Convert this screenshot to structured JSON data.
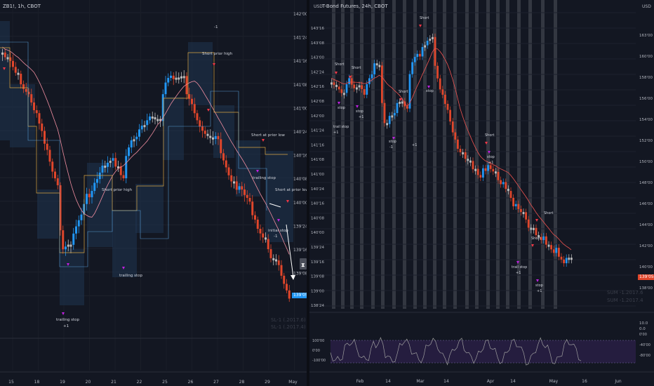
{
  "left": {
    "title": "ZB1!, 1h, CBOT",
    "price_labels": [
      "142'00",
      "141'24",
      "141'16",
      "141'08",
      "141'00",
      "140'24",
      "140'16",
      "140'08",
      "140'00",
      "139'24",
      "139'16",
      "139'08",
      "139'00"
    ],
    "current_price": "139'05",
    "date_labels": [
      "15",
      "18",
      "19",
      "20",
      "21",
      "22",
      "25",
      "26",
      "27",
      "28",
      "29",
      "May"
    ],
    "annotations": {
      "short_top": "-1",
      "short_prior_high_1": "Short prior high",
      "short_prior_high_2": "Short prior high",
      "short_at_prior_low_1": "Short at prior low",
      "short_at_prior_low_2": "Short at prior low",
      "trailing_stop_1": "trailing stop",
      "trailing_stop_1_val": "+1",
      "trailing_stop_2": "trailing stop",
      "trailing_stop_3": "trailing stop",
      "initial_stop": "initial stop",
      "initial_stop_val": "-1"
    },
    "watermark": [
      "SL-1 (.2017.6)",
      "SL-1 (.2017.4)"
    ],
    "colors": {
      "up": "#2196f3",
      "down": "#e0462b",
      "neutral": "#bdbdbd",
      "ma": "#f28ea0"
    }
  },
  "right": {
    "title": "T-Bond Futures, 24h, CBOT",
    "currency": "USD",
    "left_price_labels": [
      "143'16",
      "143'08",
      "143'00",
      "142'24",
      "142'16",
      "142'08",
      "142'00",
      "141'24",
      "141'16",
      "141'08",
      "141'00",
      "140'24",
      "140'16",
      "140'08",
      "140'00",
      "139'24",
      "139'16",
      "139'08",
      "139'00",
      "138'24"
    ],
    "right_price_labels": [
      "163'00",
      "160'00",
      "158'00",
      "156'00",
      "154'00",
      "152'00",
      "150'00",
      "148'00",
      "146'00",
      "144'00",
      "142'00",
      "140'00",
      "138'00"
    ],
    "current_price": "139'05",
    "date_labels": [
      "Feb",
      "14",
      "Mar",
      "14",
      "Apr",
      "14",
      "May",
      "16",
      "Jun"
    ],
    "osc_labels_left": [
      "100'00",
      "0'00",
      "-100'00"
    ],
    "osc_labels_right": [
      "0'00",
      "-40'00",
      "-80'00"
    ],
    "extra_labels_right": [
      "10.0",
      "0.0"
    ],
    "annotations": {
      "short_1": "Short",
      "short_2": "Short",
      "short_3": "Short",
      "short_4": "Short",
      "short_5": "Short",
      "short_6": "Short",
      "short_7": "Short",
      "trail_stop": "trail stop",
      "stop": "stop",
      "plus1": "+1",
      "minus1": "-1"
    },
    "watermark": [
      "SUM -1.2017.6",
      "SUM -1.2017.4"
    ],
    "colors": {
      "up": "#2196f3",
      "down": "#e0462b",
      "neutral": "#bdbdbd",
      "band": "#3a3d47",
      "osc": "#9e9e9e",
      "osc_bg": "#2a1f47"
    }
  }
}
